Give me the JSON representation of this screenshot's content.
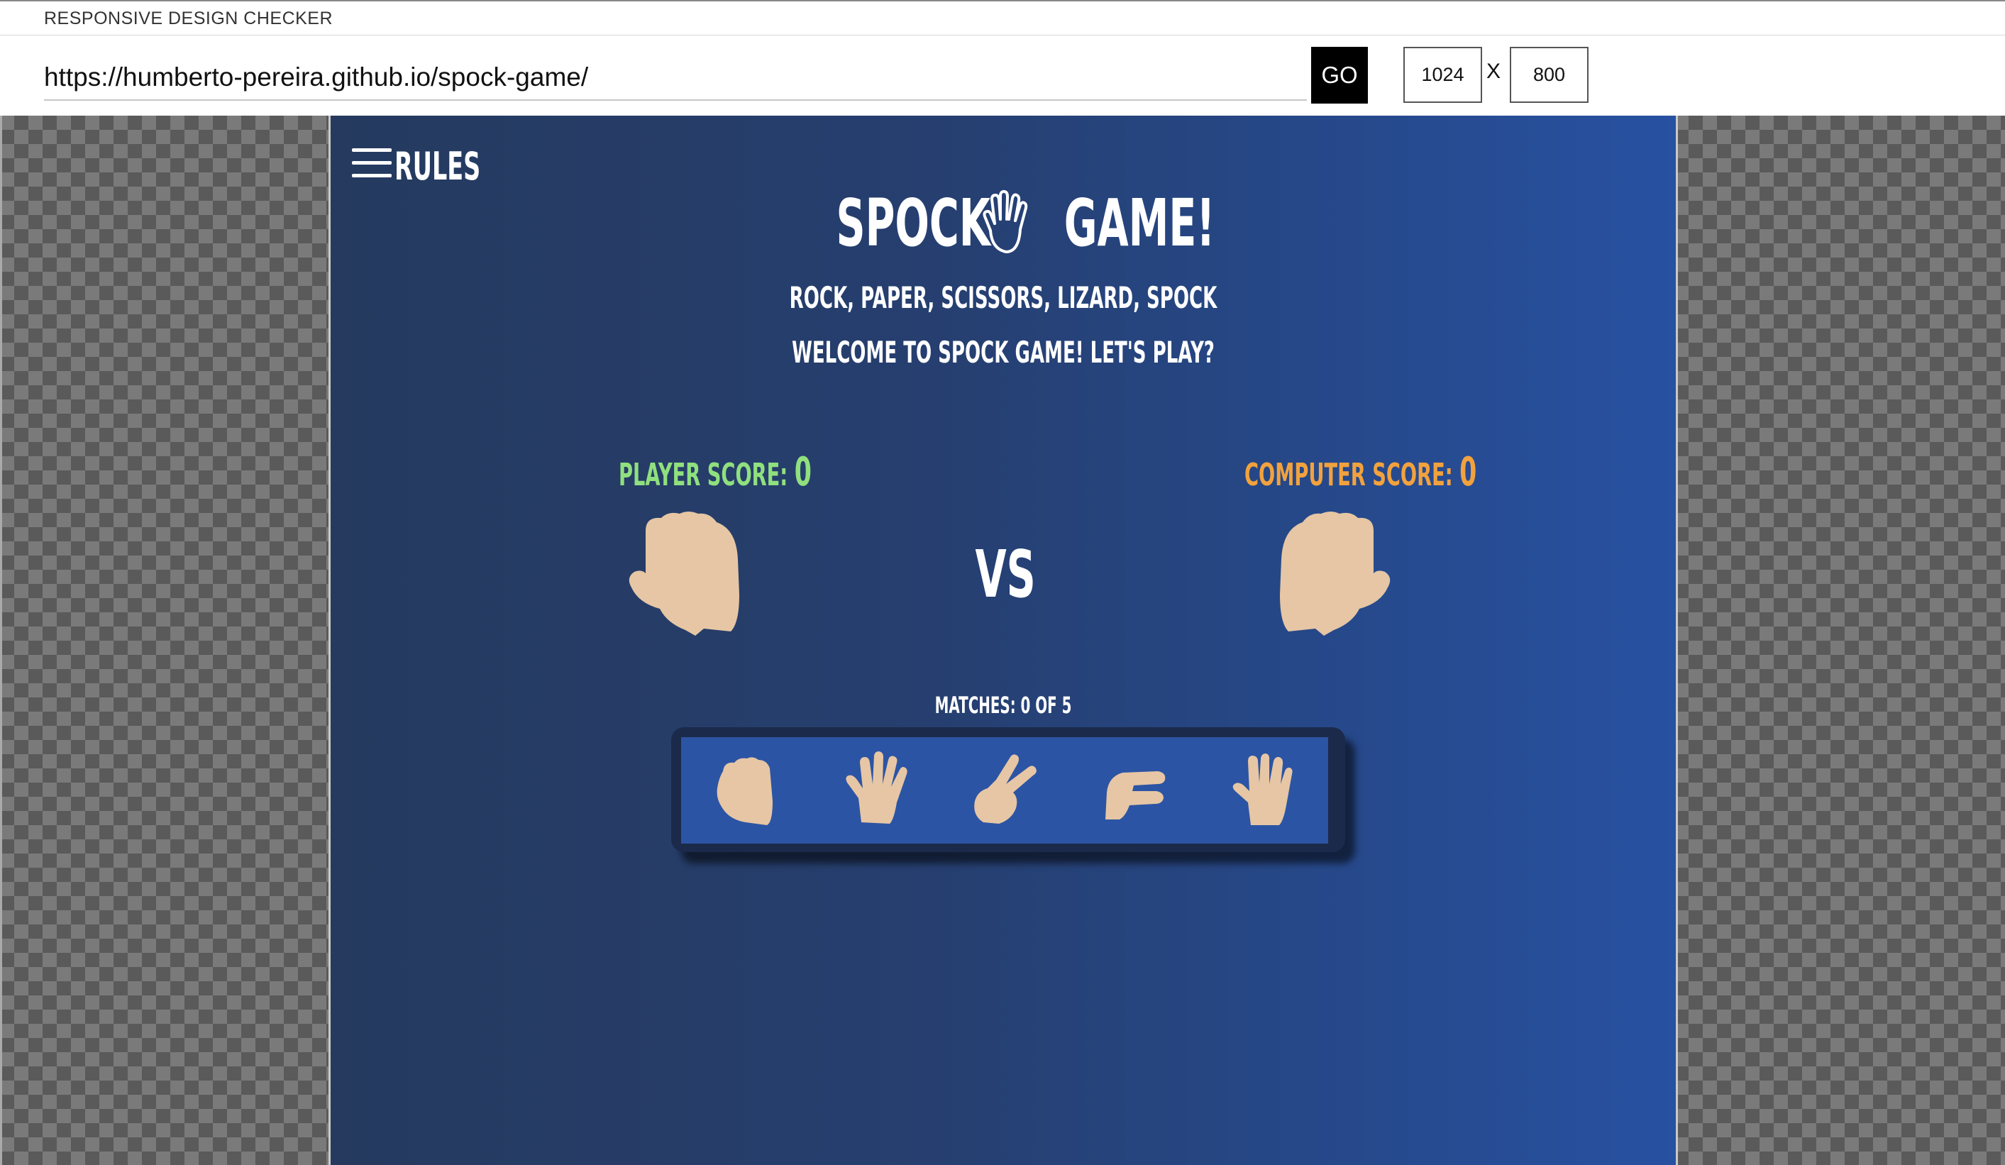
{
  "checker": {
    "app_title": "RESPONSIVE DESIGN CHECKER",
    "url": "https://humberto-pereira.github.io/spock-game/",
    "go_label": "GO",
    "width": "1024",
    "height": "800",
    "times": "X"
  },
  "game": {
    "rules_label": "RULES",
    "title_left": "SPOCK",
    "title_right": "GAME!",
    "subtitle": "ROCK, PAPER, SCISSORS, LIZARD, SPOCK",
    "welcome": "WELCOME TO SPOCK GAME! LET'S PLAY?",
    "player_score_label": "PLAYER SCORE:",
    "player_score": "0",
    "computer_score_label": "COMPUTER SCORE:",
    "computer_score": "0",
    "vs": "VS",
    "matches": "MATCHES: 0 OF 5",
    "choices": [
      "rock",
      "paper",
      "scissors",
      "lizard",
      "spock"
    ]
  },
  "colors": {
    "player": "#90e07e",
    "computer": "#f2a23d",
    "skin": "#e6c6a4",
    "tray": "#2c54a4"
  },
  "icons": {
    "menu": "hamburger-icon",
    "title": "vulcan-salute-icon",
    "player_hand": "fist-icon",
    "computer_hand": "fist-icon",
    "choices": [
      "rock-icon",
      "paper-icon",
      "scissors-icon",
      "lizard-icon",
      "spock-icon"
    ]
  }
}
